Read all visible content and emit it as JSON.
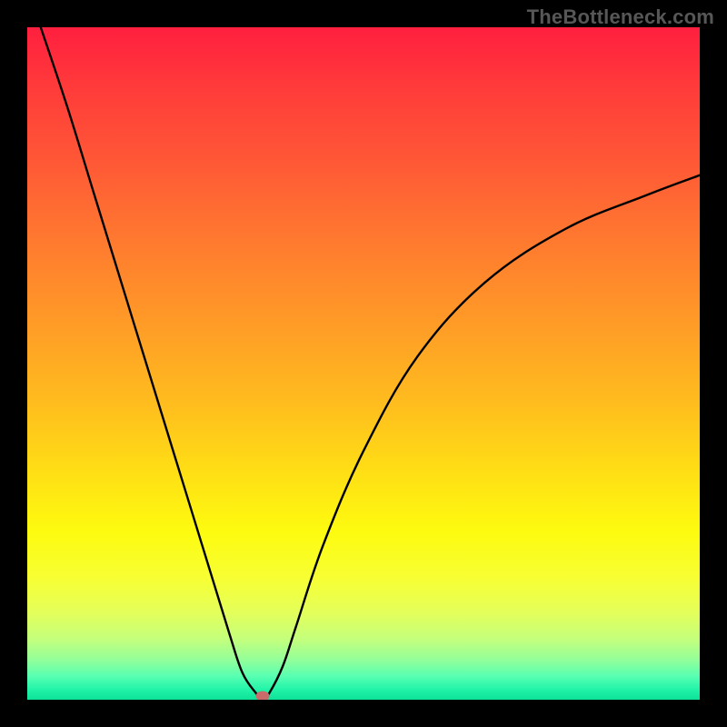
{
  "watermark": "TheBottleneck.com",
  "chart_data": {
    "type": "line",
    "title": "",
    "xlabel": "",
    "ylabel": "",
    "xlim": [
      0,
      100
    ],
    "ylim": [
      0,
      100
    ],
    "grid": false,
    "legend": false,
    "series": [
      {
        "name": "bottleneck-curve",
        "x": [
          2,
          6,
          10,
          14,
          18,
          22,
          26,
          30,
          32,
          34,
          35,
          36,
          38,
          40,
          44,
          50,
          58,
          68,
          80,
          92,
          100
        ],
        "y": [
          100,
          88,
          75,
          62,
          49,
          36,
          23,
          10,
          4,
          1,
          0,
          1,
          5,
          11,
          23,
          37,
          51,
          62,
          70,
          75,
          78
        ]
      }
    ],
    "marker": {
      "x": 35,
      "y": 0.5,
      "color": "#c96b6b"
    },
    "background_gradient": {
      "stops": [
        {
          "pos": 0.0,
          "color": "#ff1f3f"
        },
        {
          "pos": 0.5,
          "color": "#ffb021"
        },
        {
          "pos": 0.82,
          "color": "#f7ff34"
        },
        {
          "pos": 1.0,
          "color": "#0de299"
        }
      ]
    },
    "frame_color": "#000000"
  }
}
